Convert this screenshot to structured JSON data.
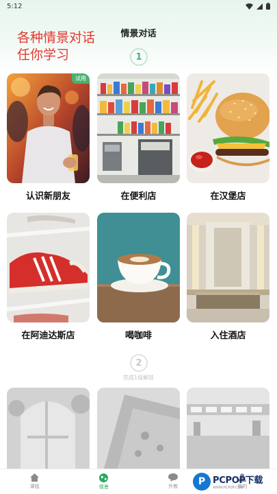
{
  "status": {
    "time": "5:12"
  },
  "header": {
    "hero_line1": "各种情景对话",
    "hero_line2": "任你学习",
    "title": "情景对话"
  },
  "steps": [
    {
      "number": "1"
    },
    {
      "number": "2",
      "hint": "完成1级解锁"
    }
  ],
  "scenes": [
    {
      "label": "认识新朋友",
      "badge": "试用"
    },
    {
      "label": "在便利店"
    },
    {
      "label": "在汉堡店"
    },
    {
      "label": "在阿迪达斯店"
    },
    {
      "label": "喝咖啡"
    },
    {
      "label": "入住酒店"
    }
  ],
  "nav": [
    {
      "label": "课程",
      "icon": "home-icon"
    },
    {
      "label": "情景",
      "icon": "globe-icon",
      "active": true
    },
    {
      "label": "外教",
      "icon": "chat-icon"
    },
    {
      "label": "我的",
      "icon": "user-icon"
    }
  ],
  "watermark": {
    "brand": "PCPOP下载",
    "sub": "WWW.PCPOP.COM",
    "logo_letter": "P"
  },
  "colors": {
    "accent": "#2eaa66",
    "hero": "#e2382e",
    "badge": "#4bb06f"
  }
}
